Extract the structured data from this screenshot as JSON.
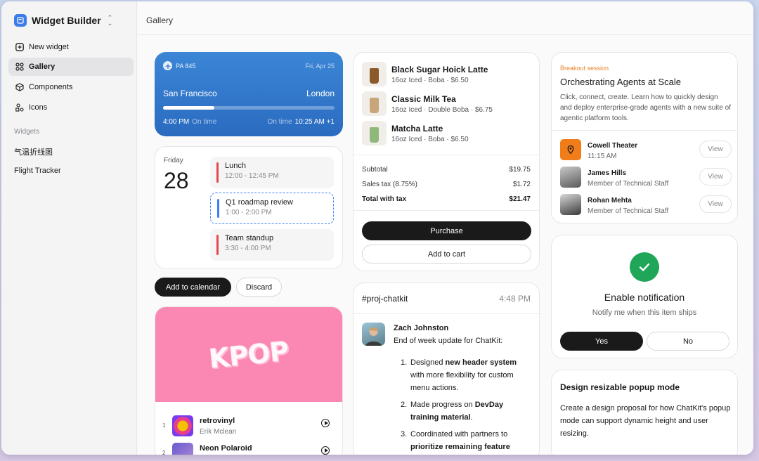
{
  "app": {
    "title": "Widget Builder"
  },
  "sidebar": {
    "items": [
      {
        "label": "New widget",
        "icon": "plus-square-icon"
      },
      {
        "label": "Gallery",
        "icon": "grid-icon"
      },
      {
        "label": "Components",
        "icon": "cube-icon"
      },
      {
        "label": "Icons",
        "icon": "shapes-icon"
      }
    ],
    "section_label": "Widgets",
    "widgets": [
      "气温折线图",
      "Flight Tracker"
    ]
  },
  "header": {
    "breadcrumb": "Gallery"
  },
  "flight": {
    "number": "PA 845",
    "date": "Fri, Apr 25",
    "origin": "San Francisco",
    "destination": "London",
    "progress": 0.3,
    "depart_time": "4:00 PM",
    "depart_status": "On time",
    "arrive_status": "On time",
    "arrive_time": "10:25 AM +1"
  },
  "calendar": {
    "weekday": "Friday",
    "day": "28",
    "events": [
      {
        "title": "Lunch",
        "time": "12:00 - 12:45 PM",
        "color": "#e5484d"
      },
      {
        "title": "Q1 roadmap review",
        "time": "1:00 - 2:00 PM",
        "color": "#3b82f6"
      },
      {
        "title": "Team standup",
        "time": "3:30 - 4:00 PM",
        "color": "#e5484d"
      }
    ],
    "add_label": "Add to calendar",
    "discard_label": "Discard"
  },
  "music": {
    "cover_text": "KPOP",
    "tracks": [
      {
        "index": "1",
        "title": "retrovinyl",
        "artist": "Erik Mclean"
      },
      {
        "index": "2",
        "title": "Neon Polaroid",
        "artist": ""
      }
    ]
  },
  "order": {
    "items": [
      {
        "name": "Black Sugar Hoick Latte",
        "desc": "16oz Iced · Boba · $6.50",
        "color": "#8a5a2b"
      },
      {
        "name": "Classic Milk Tea",
        "desc": "16oz Iced · Double Boba · $6.75",
        "color": "#c8a57a"
      },
      {
        "name": "Matcha Latte",
        "desc": "16oz Iced · Boba · $6.50",
        "color": "#8fb87a"
      }
    ],
    "subtotal_label": "Subtotal",
    "subtotal": "$19.75",
    "tax_label": "Sales tax (8.75%)",
    "tax": "$1.72",
    "total_label": "Total with tax",
    "total": "$21.47",
    "purchase_label": "Purchase",
    "cart_label": "Add to cart"
  },
  "chat": {
    "channel": "#proj-chatkit",
    "time": "4:48 PM",
    "author": "Zach Johnston",
    "message": "End of week update for ChatKit:",
    "list": [
      {
        "n": "1.",
        "pre": "Designed ",
        "bold": "new header system",
        "post": " with more flexibility for custom menu actions."
      },
      {
        "n": "2.",
        "pre": "Made progress on ",
        "bold": "DevDay training material",
        "post": "."
      },
      {
        "n": "3.",
        "pre": "Coordinated with partners to ",
        "bold": "prioritize remaining feature",
        "post": ""
      }
    ]
  },
  "session": {
    "kicker": "Breakout session",
    "title": "Orchestrating Agents at Scale",
    "description": "Click, connect, create. Learn how to quickly design and deploy enterprise-grade agents with a new suite of agentic platform tools.",
    "people": [
      {
        "name": "Cowell Theater",
        "role": "11:15 AM",
        "view": "View"
      },
      {
        "name": "James Hills",
        "role": "Member of Technical Staff",
        "view": "View"
      },
      {
        "name": "Rohan Mehta",
        "role": "Member of Technical Staff",
        "view": "View"
      }
    ]
  },
  "notify": {
    "title": "Enable notification",
    "subtitle": "Notify me when this item ships",
    "yes_label": "Yes",
    "no_label": "No"
  },
  "task": {
    "title": "Design resizable popup mode",
    "description": "Create a design proposal for how ChatKit's popup mode can support dynamic height and user resizing."
  }
}
